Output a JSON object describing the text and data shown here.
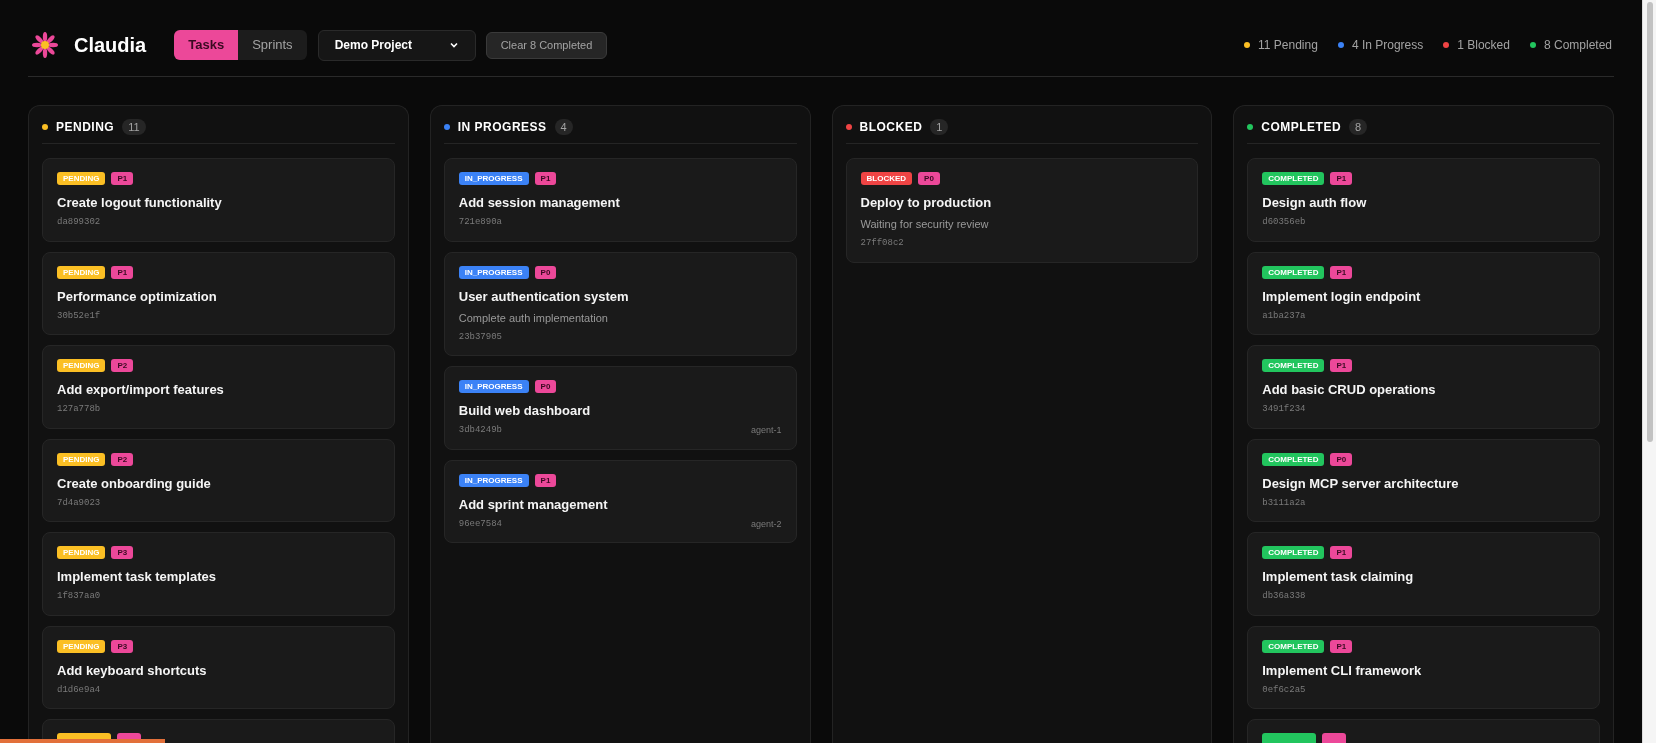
{
  "app": {
    "title": "Claudia"
  },
  "tabs": [
    {
      "label": "Tasks",
      "selected": true
    },
    {
      "label": "Sprints",
      "selected": false
    }
  ],
  "project_select": {
    "value": "Demo Project"
  },
  "clear_button": {
    "label": "Clear 8 Completed"
  },
  "summary": [
    {
      "label": "11 Pending",
      "color": "#fbbf24"
    },
    {
      "label": "4 In Progress",
      "color": "#3b82f6"
    },
    {
      "label": "1 Blocked",
      "color": "#ef4444"
    },
    {
      "label": "8 Completed",
      "color": "#22c55e"
    }
  ],
  "columns": [
    {
      "title": "PENDING",
      "count": "11",
      "color": "#fbbf24",
      "cards": [
        {
          "kind": "pending",
          "status_label": "PENDING",
          "priority": "P1",
          "title": "Create logout functionality",
          "id": "da899302"
        },
        {
          "kind": "pending",
          "status_label": "PENDING",
          "priority": "P1",
          "title": "Performance optimization",
          "id": "30b52e1f"
        },
        {
          "kind": "pending",
          "status_label": "PENDING",
          "priority": "P2",
          "title": "Add export/import features",
          "id": "127a778b"
        },
        {
          "kind": "pending",
          "status_label": "PENDING",
          "priority": "P2",
          "title": "Create onboarding guide",
          "id": "7d4a9023"
        },
        {
          "kind": "pending",
          "status_label": "PENDING",
          "priority": "P3",
          "title": "Implement task templates",
          "id": "1f837aa0"
        },
        {
          "kind": "pending",
          "status_label": "PENDING",
          "priority": "P3",
          "title": "Add keyboard shortcuts",
          "id": "d1d6e9a4"
        },
        {
          "kind": "pending",
          "cut": true
        }
      ]
    },
    {
      "title": "IN PROGRESS",
      "count": "4",
      "color": "#3b82f6",
      "cards": [
        {
          "kind": "in_progress",
          "status_label": "IN_PROGRESS",
          "priority": "P1",
          "title": "Add session management",
          "id": "721e890a"
        },
        {
          "kind": "in_progress",
          "status_label": "IN_PROGRESS",
          "priority": "P0",
          "title": "User authentication system",
          "description": "Complete auth implementation",
          "id": "23b37905"
        },
        {
          "kind": "in_progress",
          "status_label": "IN_PROGRESS",
          "priority": "P0",
          "title": "Build web dashboard",
          "id": "3db4249b",
          "agent": "agent-1"
        },
        {
          "kind": "in_progress",
          "status_label": "IN_PROGRESS",
          "priority": "P1",
          "title": "Add sprint management",
          "id": "96ee7584",
          "agent": "agent-2"
        }
      ]
    },
    {
      "title": "BLOCKED",
      "count": "1",
      "color": "#ef4444",
      "cards": [
        {
          "kind": "blocked",
          "status_label": "BLOCKED",
          "priority": "P0",
          "title": "Deploy to production",
          "description": "Waiting for security review",
          "id": "27ff08c2"
        }
      ]
    },
    {
      "title": "COMPLETED",
      "count": "8",
      "color": "#22c55e",
      "cards": [
        {
          "kind": "completed",
          "status_label": "COMPLETED",
          "priority": "P1",
          "title": "Design auth flow",
          "id": "d60356eb"
        },
        {
          "kind": "completed",
          "status_label": "COMPLETED",
          "priority": "P1",
          "title": "Implement login endpoint",
          "id": "a1ba237a"
        },
        {
          "kind": "completed",
          "status_label": "COMPLETED",
          "priority": "P1",
          "title": "Add basic CRUD operations",
          "id": "3491f234"
        },
        {
          "kind": "completed",
          "status_label": "COMPLETED",
          "priority": "P0",
          "title": "Design MCP server architecture",
          "id": "b3111a2a"
        },
        {
          "kind": "completed",
          "status_label": "COMPLETED",
          "priority": "P1",
          "title": "Implement task claiming",
          "id": "db36a338"
        },
        {
          "kind": "completed",
          "status_label": "COMPLETED",
          "priority": "P1",
          "title": "Implement CLI framework",
          "id": "0ef6c2a5"
        },
        {
          "kind": "completed",
          "cut": true
        }
      ]
    }
  ]
}
